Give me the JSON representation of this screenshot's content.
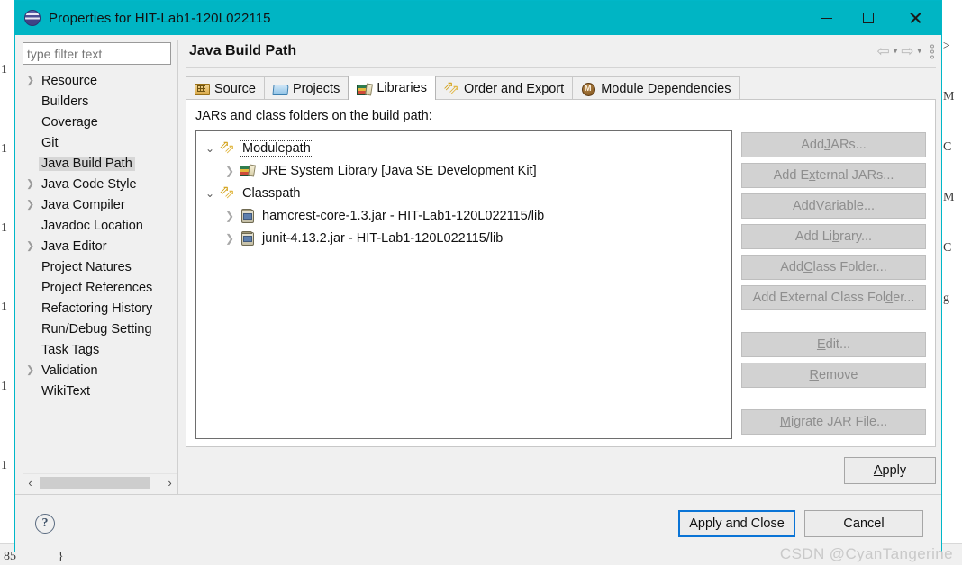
{
  "window": {
    "title": "Properties for HIT-Lab1-120L022115",
    "app_icon": "eclipse-icon",
    "titlebar_color": "#00b5c4",
    "controls": {
      "minimize": "minimize-icon",
      "maximize": "maximize-icon",
      "close": "close-icon"
    }
  },
  "sidebar": {
    "filter": {
      "placeholder": "type filter text",
      "value": ""
    },
    "items": [
      {
        "label": "Resource",
        "expandable": true,
        "selected": false
      },
      {
        "label": "Builders",
        "expandable": false,
        "selected": false
      },
      {
        "label": "Coverage",
        "expandable": false,
        "selected": false
      },
      {
        "label": "Git",
        "expandable": false,
        "selected": false
      },
      {
        "label": "Java Build Path",
        "expandable": false,
        "selected": true
      },
      {
        "label": "Java Code Style",
        "expandable": true,
        "selected": false
      },
      {
        "label": "Java Compiler",
        "expandable": true,
        "selected": false
      },
      {
        "label": "Javadoc Location",
        "expandable": false,
        "selected": false
      },
      {
        "label": "Java Editor",
        "expandable": true,
        "selected": false
      },
      {
        "label": "Project Natures",
        "expandable": false,
        "selected": false
      },
      {
        "label": "Project References",
        "expandable": false,
        "selected": false
      },
      {
        "label": "Refactoring History",
        "expandable": false,
        "selected": false
      },
      {
        "label": "Run/Debug Setting",
        "expandable": false,
        "selected": false
      },
      {
        "label": "Task Tags",
        "expandable": false,
        "selected": false
      },
      {
        "label": "Validation",
        "expandable": true,
        "selected": false
      },
      {
        "label": "WikiText",
        "expandable": false,
        "selected": false
      }
    ],
    "scrollbar": {
      "left_arrow": "‹",
      "right_arrow": "›"
    }
  },
  "page": {
    "title": "Java Build Path",
    "nav": {
      "back": "back-arrow-icon",
      "back_caret": "▾",
      "forward": "forward-arrow-icon",
      "forward_caret": "▾",
      "menu": "view-menu-icon"
    }
  },
  "tabs": [
    {
      "label": "Source",
      "icon": "source-folder-icon",
      "active": false
    },
    {
      "label": "Projects",
      "icon": "projects-folder-icon",
      "active": false
    },
    {
      "label": "Libraries",
      "icon": "libraries-books-icon",
      "active": true
    },
    {
      "label": "Order and Export",
      "icon": "order-export-arrows-icon",
      "active": false
    },
    {
      "label": "Module Dependencies",
      "icon": "module-circle-icon",
      "active": false
    }
  ],
  "libraries": {
    "caption_pre": "JARs and class folders on the build pat",
    "caption_mnemonic": "h",
    "caption_post": ":",
    "tree": [
      {
        "label": "Modulepath",
        "icon": "modulepath-icon",
        "twisty": "⌄",
        "indent": 0,
        "focused": true
      },
      {
        "label": "JRE System Library [Java SE Development Kit]",
        "icon": "jre-library-icon",
        "twisty": "›",
        "indent": 1,
        "focused": false
      },
      {
        "label": "Classpath",
        "icon": "classpath-icon",
        "twisty": "⌄",
        "indent": 0,
        "focused": false
      },
      {
        "label": "hamcrest-core-1.3.jar - HIT-Lab1-120L022115/lib",
        "icon": "jar-icon",
        "twisty": "›",
        "indent": 1,
        "focused": false
      },
      {
        "label": "junit-4.13.2.jar - HIT-Lab1-120L022115/lib",
        "icon": "jar-icon",
        "twisty": "›",
        "indent": 1,
        "focused": false
      }
    ],
    "buttons": [
      {
        "pre": "Add ",
        "mnemonic": "J",
        "post": "ARs...",
        "enabled": false,
        "gap_before": false
      },
      {
        "pre": "Add E",
        "mnemonic": "x",
        "post": "ternal JARs...",
        "enabled": false,
        "gap_before": false
      },
      {
        "pre": "Add ",
        "mnemonic": "V",
        "post": "ariable...",
        "enabled": false,
        "gap_before": false
      },
      {
        "pre": "Add Li",
        "mnemonic": "b",
        "post": "rary...",
        "enabled": false,
        "gap_before": false
      },
      {
        "pre": "Add ",
        "mnemonic": "C",
        "post": "lass Folder...",
        "enabled": false,
        "gap_before": false
      },
      {
        "pre": "Add External Class Fol",
        "mnemonic": "d",
        "post": "er...",
        "enabled": false,
        "gap_before": false
      },
      {
        "pre": "",
        "mnemonic": "E",
        "post": "dit...",
        "enabled": false,
        "gap_before": true
      },
      {
        "pre": "",
        "mnemonic": "R",
        "post": "emove",
        "enabled": false,
        "gap_before": false
      },
      {
        "pre": "",
        "mnemonic": "M",
        "post": "igrate JAR File...",
        "enabled": false,
        "gap_before": true
      }
    ]
  },
  "apply": {
    "pre": "",
    "mnemonic": "A",
    "post": "pply"
  },
  "footer": {
    "help": "?",
    "apply_and_close": "Apply and Close",
    "cancel": "Cancel",
    "focus_color": "#0a74d6"
  },
  "watermark": "CSDN @CyanTangerine",
  "background": {
    "left_glyphs": [
      "1",
      "1",
      "1",
      "1",
      "1",
      "1"
    ],
    "right_glyphs": [
      "≥",
      "M",
      "C",
      "M",
      "C",
      "g"
    ],
    "bottom_glyphs": [
      "85",
      "}"
    ]
  }
}
